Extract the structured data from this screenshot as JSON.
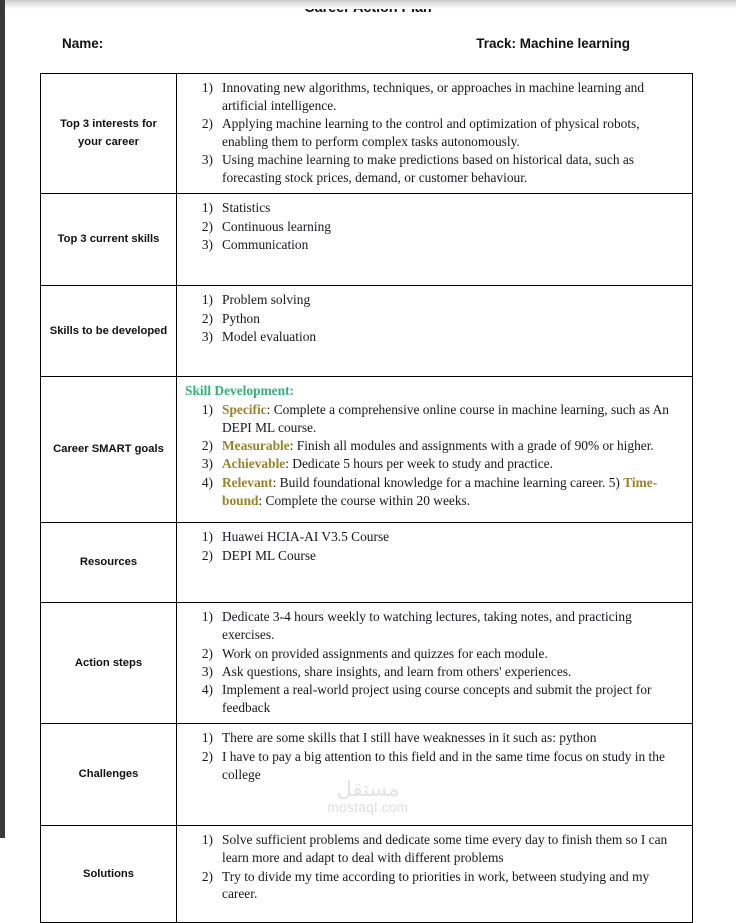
{
  "document": {
    "title": "Career Action Plan",
    "name_label": "Name:",
    "track_label": "Track: Machine learning"
  },
  "colors": {
    "smart_heading_green": "#2fb476",
    "smart_keyword_gold": "#9a8327",
    "table_border": "#000000",
    "body_text": "#16181d",
    "watermark_gray": "#e0e0e0"
  },
  "watermark": {
    "arabic": "مستقل",
    "latin": "mostaql.com"
  },
  "rows": {
    "interests": {
      "label": "Top 3 interests for your career",
      "items": [
        {
          "n": "1)",
          "text": "Innovating new algorithms, techniques, or approaches in machine learning and artificial intelligence."
        },
        {
          "n": "2)",
          "text": "Applying machine learning to the control and optimization of physical robots, enabling them to perform complex tasks autonomously."
        },
        {
          "n": "3)",
          "text": "Using machine learning to make predictions based on historical data, such as forecasting stock prices, demand, or customer behaviour."
        }
      ]
    },
    "current_skills": {
      "label": "Top 3 current skills",
      "items": [
        {
          "n": "1)",
          "text": "Statistics"
        },
        {
          "n": "2)",
          "text": "Continuous learning"
        },
        {
          "n": "3)",
          "text": "Communication"
        }
      ]
    },
    "skills_to_develop": {
      "label": "Skills to be developed",
      "items": [
        {
          "n": "1)",
          "text": "Problem solving"
        },
        {
          "n": "2)",
          "text": "Python"
        },
        {
          "n": "3)",
          "text": "Model evaluation"
        }
      ]
    },
    "smart_goals": {
      "label": "Career SMART goals",
      "heading": "Skill Development:",
      "items": [
        {
          "n": "1)",
          "key": "Specific",
          "text": ": Complete a comprehensive online course in machine learning, such as An DEPI ML course."
        },
        {
          "n": "2)",
          "key": "Measurable",
          "text": ": Finish all modules and assignments with a grade of 90% or higher."
        },
        {
          "n": "3)",
          "key": "Achievable",
          "text": ": Dedicate 5 hours per week to study and practice."
        },
        {
          "n": "4)",
          "key": "Relevant",
          "text": ": Build foundational knowledge for a machine learning career. 5) ",
          "key2": "Time-bound",
          "text2": ": Complete the course within 20 weeks."
        }
      ]
    },
    "resources": {
      "label": "Resources",
      "items": [
        {
          "n": "1)",
          "text": "Huawei HCIA-AI V3.5 Course"
        },
        {
          "n": "2)",
          "text": "DEPI ML Course"
        }
      ]
    },
    "action_steps": {
      "label": "Action steps",
      "items": [
        {
          "n": "1)",
          "text": "Dedicate 3-4 hours weekly to watching lectures, taking notes, and practicing exercises."
        },
        {
          "n": "2)",
          "text": "Work on provided assignments and quizzes for each module."
        },
        {
          "n": "3)",
          "text": "Ask questions, share insights, and learn from others' experiences."
        },
        {
          "n": "4)",
          "text": "Implement a real-world project using course concepts and submit the project for feedback"
        }
      ]
    },
    "challenges": {
      "label": "Challenges",
      "items": [
        {
          "n": "1)",
          "text": "There are some skills that I still have weaknesses in it such as: python"
        },
        {
          "n": "2)",
          "text": "I have to pay a big attention to this field and in the same time focus on study in the college"
        }
      ]
    },
    "solutions": {
      "label": "Solutions",
      "items": [
        {
          "n": "1)",
          "text": "Solve sufficient problems and dedicate some time every day to finish them so I can learn more and adapt to deal with different problems"
        },
        {
          "n": "2)",
          "text": "Try to divide my time according to priorities in work, between studying and my career."
        }
      ]
    }
  }
}
